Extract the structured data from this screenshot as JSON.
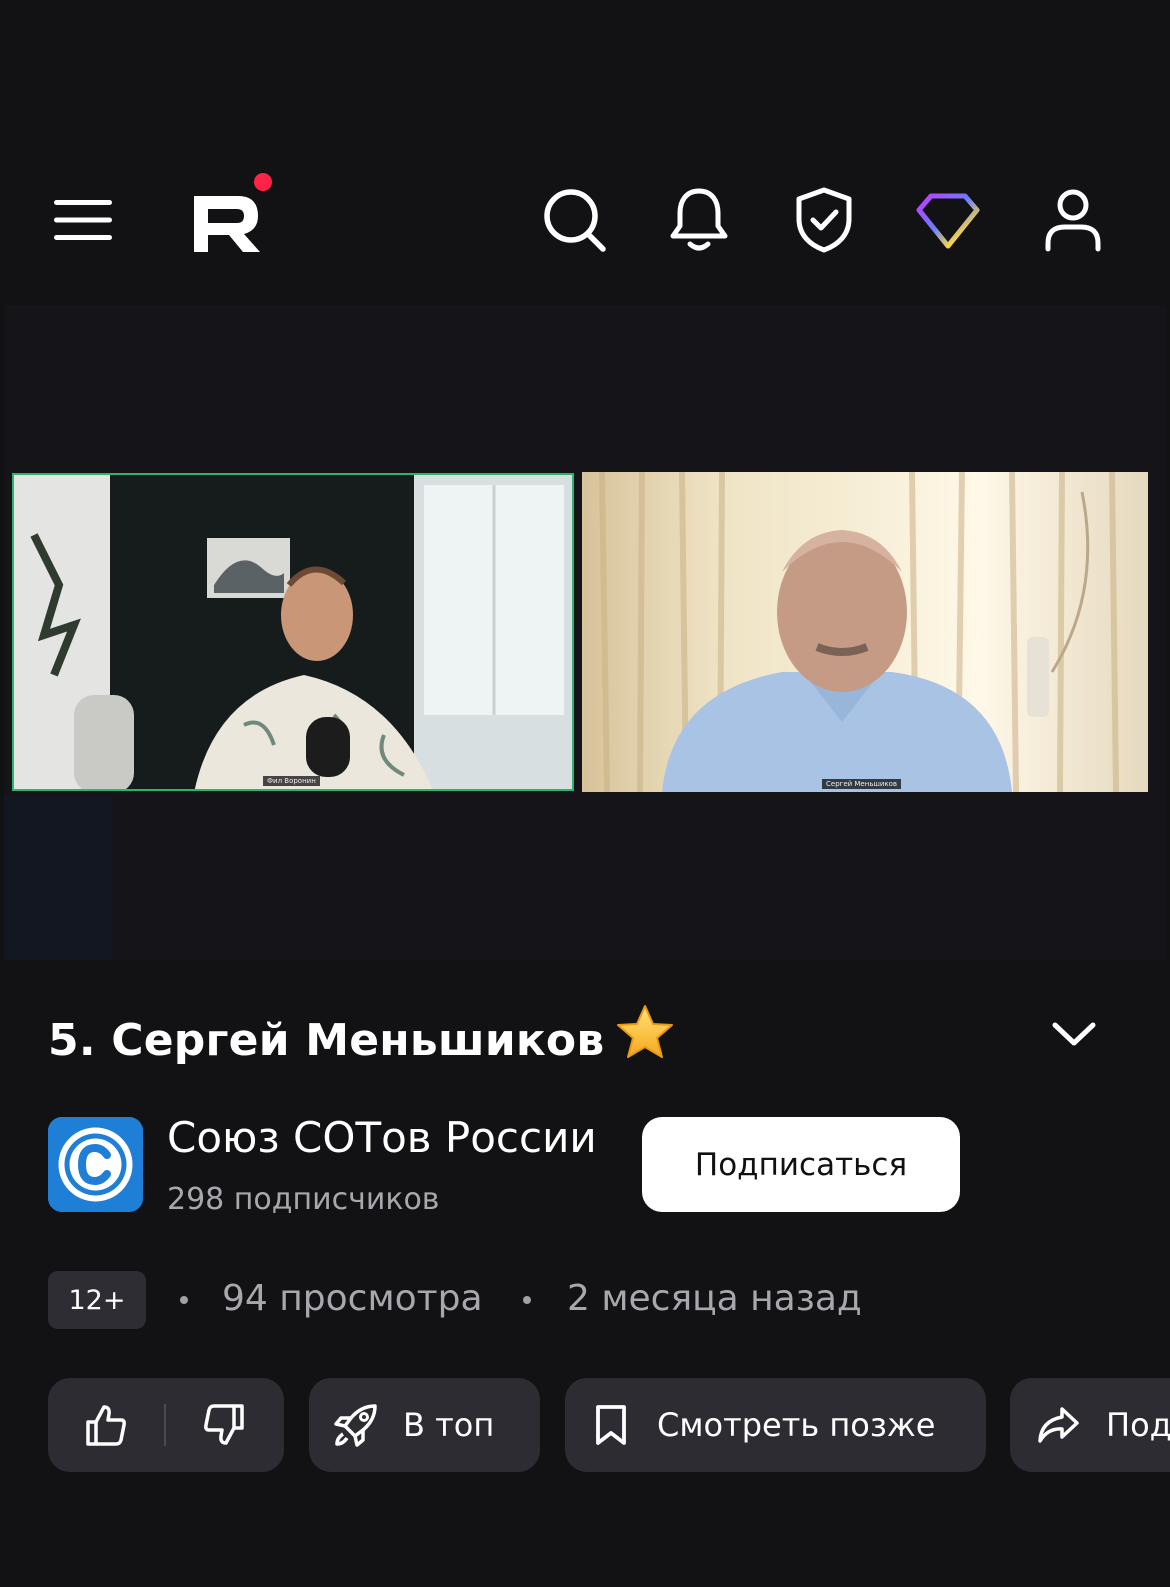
{
  "header": {
    "icons": [
      "menu-icon",
      "rutube-logo",
      "search-icon",
      "bell-icon",
      "shield-check-icon",
      "diamond-icon",
      "user-icon"
    ],
    "logo_letter": "R",
    "logo_dot_color": "#ff2446"
  },
  "player": {
    "participants": [
      {
        "name": "Фил Воронин"
      },
      {
        "name": "Сергей Меньшиков"
      }
    ],
    "active_speaker_color": "#2fb36b"
  },
  "video": {
    "title": "5. Сергей Меньшиков",
    "title_emoji": "star-icon"
  },
  "channel": {
    "name": "Союз СОТов России",
    "subscribers": "298 подписчиков",
    "subscribe_label": "Подписаться",
    "logo_color": "#1f7fd6"
  },
  "meta": {
    "age_rating": "12+",
    "views": "94 просмотра",
    "published": "2 месяца назад"
  },
  "actions": {
    "to_top_label": "В топ",
    "watch_later_label": "Смотреть позже",
    "share_label_visible": "Под"
  },
  "colors": {
    "background": "#121215",
    "button_bg": "#2c2c32",
    "muted_text": "#a7a7ad"
  }
}
